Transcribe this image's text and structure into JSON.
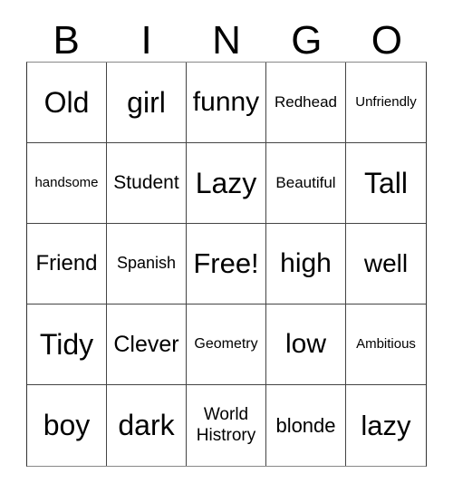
{
  "card": {
    "title": "BINGO",
    "columns": [
      "B",
      "I",
      "N",
      "G",
      "O"
    ],
    "free_space_label": "Free!",
    "cells": [
      {
        "text": "Old",
        "size": "fs-32"
      },
      {
        "text": "girl",
        "size": "fs-32"
      },
      {
        "text": "funny",
        "size": "fs-30"
      },
      {
        "text": "Redhead",
        "size": "fs-17"
      },
      {
        "text": "Unfriendly",
        "size": "fs-15"
      },
      {
        "text": "handsome",
        "size": "fs-15"
      },
      {
        "text": "Student",
        "size": "fs-21"
      },
      {
        "text": "Lazy",
        "size": "fs-32"
      },
      {
        "text": "Beautiful",
        "size": "fs-17"
      },
      {
        "text": "Tall",
        "size": "fs-32"
      },
      {
        "text": "Friend",
        "size": "fs-24"
      },
      {
        "text": "Spanish",
        "size": "fs-18"
      },
      {
        "text": "Free!",
        "size": "fs-31"
      },
      {
        "text": "high",
        "size": "fs-30"
      },
      {
        "text": "well",
        "size": "fs-28"
      },
      {
        "text": "Tidy",
        "size": "fs-32"
      },
      {
        "text": "Clever",
        "size": "fs-25"
      },
      {
        "text": "Geometry",
        "size": "fs-16"
      },
      {
        "text": "low",
        "size": "fs-30"
      },
      {
        "text": "Ambitious",
        "size": "fs-15"
      },
      {
        "text": "boy",
        "size": "fs-32"
      },
      {
        "text": "dark",
        "size": "fs-32"
      },
      {
        "text": "World\nHistrory",
        "size": "fs-19"
      },
      {
        "text": "blonde",
        "size": "fs-22"
      },
      {
        "text": "lazy",
        "size": "fs-31"
      }
    ]
  },
  "colors": {
    "background": "#ffffff",
    "text": "#000000",
    "grid_line": "#444444",
    "grid_outer": "#888888"
  }
}
